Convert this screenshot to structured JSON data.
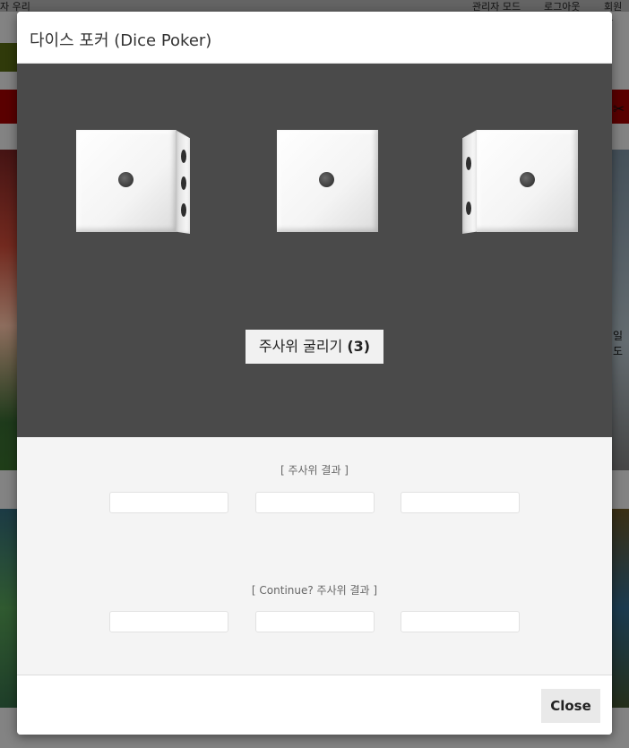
{
  "background": {
    "top_left_text": "자 우리",
    "top_links": [
      "관리자 모드",
      "로그아웃",
      "회원가"
    ],
    "side_text": "일도"
  },
  "modal": {
    "title": "다이스 포커 (Dice Poker)",
    "roll_button": {
      "label": "주사위 굴리기",
      "count": "(3)"
    },
    "dice": [
      {
        "face": 1
      },
      {
        "face": 1
      },
      {
        "face": 1
      }
    ],
    "results_label": "[ 주사위 결과 ]",
    "results": [
      "",
      "",
      ""
    ],
    "continue_label": "[ Continue? 주사위 결과 ]",
    "continue_results": [
      "",
      "",
      ""
    ],
    "close_label": "Close"
  }
}
